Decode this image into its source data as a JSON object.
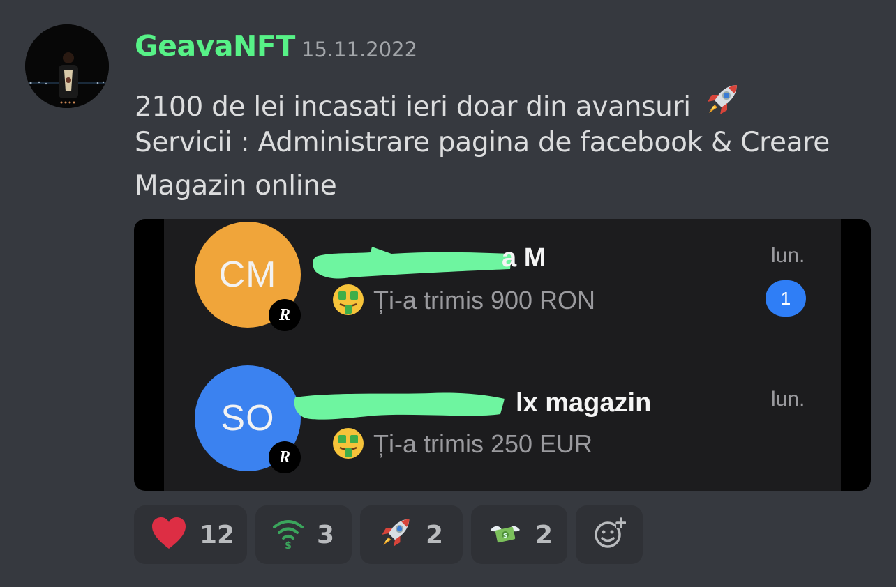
{
  "message": {
    "author": "GeavaNFT",
    "timestamp": "15.11.2022",
    "lines": [
      "2100 de lei incasati ieri doar din avansuri",
      "Servicii : Administrare pagina de facebook & Creare",
      "Magazin online"
    ],
    "line1_emoji": "rocket-icon"
  },
  "attachment": {
    "contacts": [
      {
        "initials": "CM",
        "avatar_color": "#f0a53a",
        "name_visible": "a M",
        "preview": "Ți-a trimis 900 RON",
        "time": "lun.",
        "unread": "1",
        "badge": "R"
      },
      {
        "initials": "SO",
        "avatar_color": "#3b82f0",
        "name_visible": "lx magazin",
        "preview": "Ți-a trimis 250 EUR",
        "time": "lun.",
        "badge": "R"
      }
    ]
  },
  "reactions": [
    {
      "icon": "heart-icon",
      "count": "12"
    },
    {
      "icon": "wifi-money-icon",
      "count": "3"
    },
    {
      "icon": "rocket-icon",
      "count": "2"
    },
    {
      "icon": "money-wings-icon",
      "count": "2"
    }
  ],
  "add_reaction_icon": "add-reaction-icon",
  "colors": {
    "background": "#36393f",
    "username": "#57f287",
    "reaction_bg": "#2f3136",
    "redaction": "#6ef5a0"
  }
}
